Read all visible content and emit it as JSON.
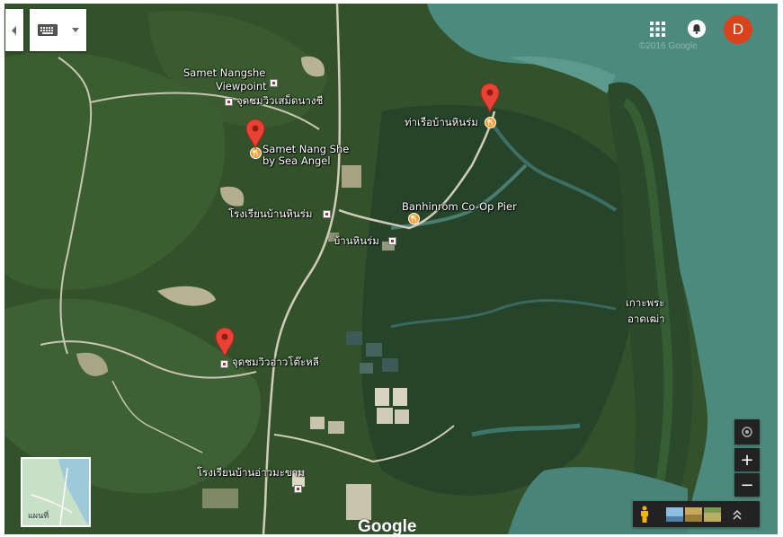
{
  "map": {
    "type": "satellite",
    "labels": {
      "samet_nangshe_viewpoint_en_1": "Samet Nangshe",
      "samet_nangshe_viewpoint_en_2": "Viewpoint",
      "samet_nangshe_viewpoint_th": "จุดชมวิวเสม็ดนางชี",
      "samet_sea_angel_1": "Samet Nang She",
      "samet_sea_angel_2": "by Sea Angel",
      "pier_th": "ท่าเรือบ้านหินร่ม",
      "school_hinrom": "โรงเรียนบ้านหินร่ม",
      "co_op_pier": "Banhinrom Co-Op Pier",
      "village_hinrom": "บ้านหินร่ม",
      "ko_phra_1": "เกาะพระ",
      "ko_phra_2": "อาดเฒ่า",
      "ao_to_li_viewpoint": "จุดชมวิวอ่าวโต๊ะหลี",
      "school_ao_makham": "โรงเรียนบ้านอ่าวมะขาม"
    },
    "watermark": "©2016 Google",
    "logo": "Google"
  },
  "controls": {
    "collapse_icon": "chevron-left-icon",
    "keyboard_icon": "keyboard-icon",
    "dropdown_icon": "caret-down-icon",
    "apps_icon": "apps-grid-icon",
    "notifications_icon": "bell-icon",
    "account_initial": "D",
    "my_location_icon": "my-location-icon",
    "zoom_in": "+",
    "zoom_out": "−",
    "pegman_icon": "pegman-icon",
    "expand_icon": "double-chevron-up-icon",
    "minimap_label": "แผนที่"
  },
  "colors": {
    "pin_red": "#e94235",
    "poi_orange": "#f2a12e",
    "avatar_bg": "#d9431c",
    "water": "#4d8a7e",
    "forest": "#2f4f2a"
  }
}
